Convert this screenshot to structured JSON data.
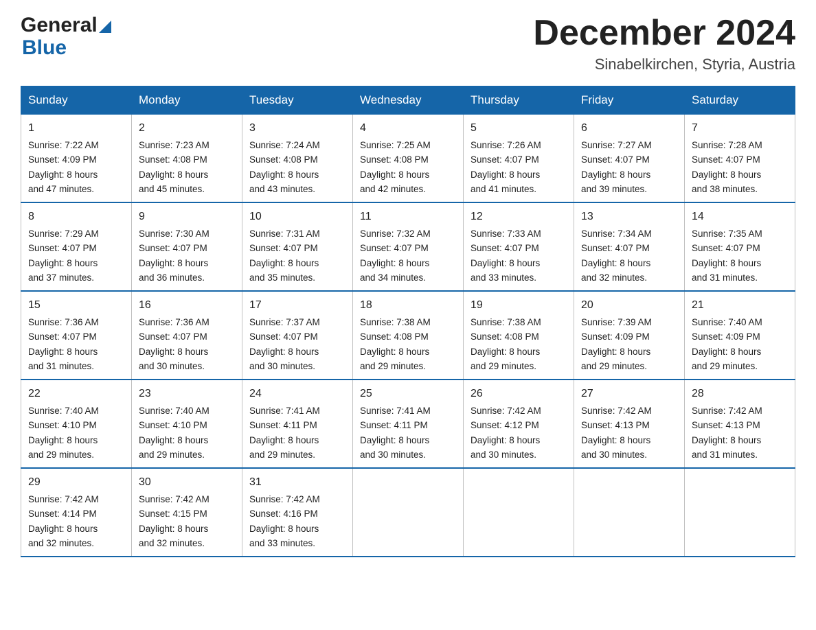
{
  "header": {
    "month_title": "December 2024",
    "location": "Sinabelkirchen, Styria, Austria",
    "logo_general": "General",
    "logo_blue": "Blue"
  },
  "days_of_week": [
    "Sunday",
    "Monday",
    "Tuesday",
    "Wednesday",
    "Thursday",
    "Friday",
    "Saturday"
  ],
  "weeks": [
    [
      {
        "day": "1",
        "sunrise": "7:22 AM",
        "sunset": "4:09 PM",
        "daylight": "8 hours and 47 minutes."
      },
      {
        "day": "2",
        "sunrise": "7:23 AM",
        "sunset": "4:08 PM",
        "daylight": "8 hours and 45 minutes."
      },
      {
        "day": "3",
        "sunrise": "7:24 AM",
        "sunset": "4:08 PM",
        "daylight": "8 hours and 43 minutes."
      },
      {
        "day": "4",
        "sunrise": "7:25 AM",
        "sunset": "4:08 PM",
        "daylight": "8 hours and 42 minutes."
      },
      {
        "day": "5",
        "sunrise": "7:26 AM",
        "sunset": "4:07 PM",
        "daylight": "8 hours and 41 minutes."
      },
      {
        "day": "6",
        "sunrise": "7:27 AM",
        "sunset": "4:07 PM",
        "daylight": "8 hours and 39 minutes."
      },
      {
        "day": "7",
        "sunrise": "7:28 AM",
        "sunset": "4:07 PM",
        "daylight": "8 hours and 38 minutes."
      }
    ],
    [
      {
        "day": "8",
        "sunrise": "7:29 AM",
        "sunset": "4:07 PM",
        "daylight": "8 hours and 37 minutes."
      },
      {
        "day": "9",
        "sunrise": "7:30 AM",
        "sunset": "4:07 PM",
        "daylight": "8 hours and 36 minutes."
      },
      {
        "day": "10",
        "sunrise": "7:31 AM",
        "sunset": "4:07 PM",
        "daylight": "8 hours and 35 minutes."
      },
      {
        "day": "11",
        "sunrise": "7:32 AM",
        "sunset": "4:07 PM",
        "daylight": "8 hours and 34 minutes."
      },
      {
        "day": "12",
        "sunrise": "7:33 AM",
        "sunset": "4:07 PM",
        "daylight": "8 hours and 33 minutes."
      },
      {
        "day": "13",
        "sunrise": "7:34 AM",
        "sunset": "4:07 PM",
        "daylight": "8 hours and 32 minutes."
      },
      {
        "day": "14",
        "sunrise": "7:35 AM",
        "sunset": "4:07 PM",
        "daylight": "8 hours and 31 minutes."
      }
    ],
    [
      {
        "day": "15",
        "sunrise": "7:36 AM",
        "sunset": "4:07 PM",
        "daylight": "8 hours and 31 minutes."
      },
      {
        "day": "16",
        "sunrise": "7:36 AM",
        "sunset": "4:07 PM",
        "daylight": "8 hours and 30 minutes."
      },
      {
        "day": "17",
        "sunrise": "7:37 AM",
        "sunset": "4:07 PM",
        "daylight": "8 hours and 30 minutes."
      },
      {
        "day": "18",
        "sunrise": "7:38 AM",
        "sunset": "4:08 PM",
        "daylight": "8 hours and 29 minutes."
      },
      {
        "day": "19",
        "sunrise": "7:38 AM",
        "sunset": "4:08 PM",
        "daylight": "8 hours and 29 minutes."
      },
      {
        "day": "20",
        "sunrise": "7:39 AM",
        "sunset": "4:09 PM",
        "daylight": "8 hours and 29 minutes."
      },
      {
        "day": "21",
        "sunrise": "7:40 AM",
        "sunset": "4:09 PM",
        "daylight": "8 hours and 29 minutes."
      }
    ],
    [
      {
        "day": "22",
        "sunrise": "7:40 AM",
        "sunset": "4:10 PM",
        "daylight": "8 hours and 29 minutes."
      },
      {
        "day": "23",
        "sunrise": "7:40 AM",
        "sunset": "4:10 PM",
        "daylight": "8 hours and 29 minutes."
      },
      {
        "day": "24",
        "sunrise": "7:41 AM",
        "sunset": "4:11 PM",
        "daylight": "8 hours and 29 minutes."
      },
      {
        "day": "25",
        "sunrise": "7:41 AM",
        "sunset": "4:11 PM",
        "daylight": "8 hours and 30 minutes."
      },
      {
        "day": "26",
        "sunrise": "7:42 AM",
        "sunset": "4:12 PM",
        "daylight": "8 hours and 30 minutes."
      },
      {
        "day": "27",
        "sunrise": "7:42 AM",
        "sunset": "4:13 PM",
        "daylight": "8 hours and 30 minutes."
      },
      {
        "day": "28",
        "sunrise": "7:42 AM",
        "sunset": "4:13 PM",
        "daylight": "8 hours and 31 minutes."
      }
    ],
    [
      {
        "day": "29",
        "sunrise": "7:42 AM",
        "sunset": "4:14 PM",
        "daylight": "8 hours and 32 minutes."
      },
      {
        "day": "30",
        "sunrise": "7:42 AM",
        "sunset": "4:15 PM",
        "daylight": "8 hours and 32 minutes."
      },
      {
        "day": "31",
        "sunrise": "7:42 AM",
        "sunset": "4:16 PM",
        "daylight": "8 hours and 33 minutes."
      },
      null,
      null,
      null,
      null
    ]
  ],
  "labels": {
    "sunrise": "Sunrise:",
    "sunset": "Sunset:",
    "daylight": "Daylight:"
  },
  "colors": {
    "header_bg": "#1565a8",
    "header_text": "#ffffff",
    "border": "#1565a8"
  }
}
